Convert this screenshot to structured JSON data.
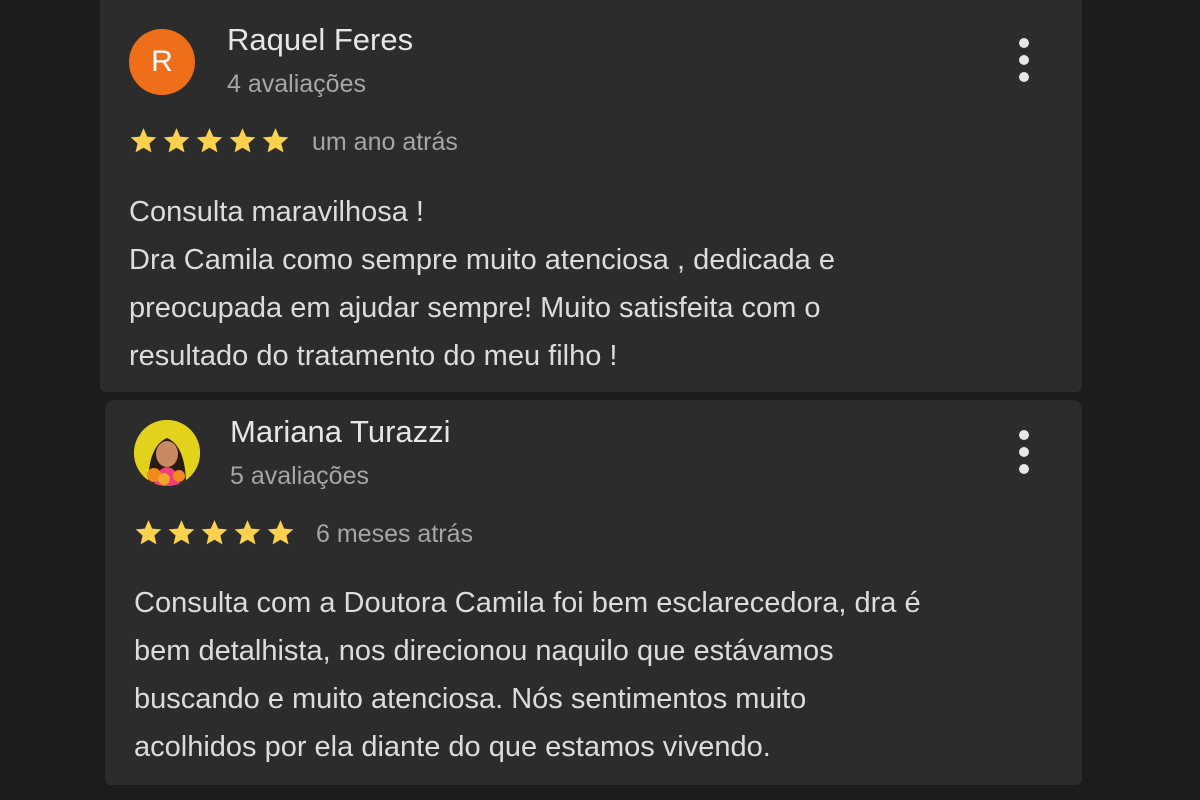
{
  "colors": {
    "background": "#1c1c1c",
    "card": "#2c2c2c",
    "avatar_orange": "#ee6e1a",
    "star": "#fbd24e",
    "text_primary": "#e6e6e6",
    "text_secondary": "#a6a6a6"
  },
  "reviews": [
    {
      "avatar_letter": "R",
      "name": "Raquel Feres",
      "reviews_count": "4 avaliações",
      "rating": 5,
      "date": "um ano atrás",
      "text_lines": [
        "Consulta maravilhosa !",
        "Dra Camila como sempre muito atenciosa , dedicada e",
        "preocupada em ajudar sempre! Muito satisfeita com o",
        "resultado do tratamento do meu filho !"
      ],
      "menu_icon": "more-vert-icon"
    },
    {
      "avatar_letter": "",
      "name": "Mariana Turazzi",
      "reviews_count": "5 avaliações",
      "rating": 5,
      "date": "6 meses atrás",
      "text_lines": [
        "Consulta com a Doutora Camila foi bem esclarecedora, dra é",
        "bem detalhista, nos direcionou naquilo que estávamos",
        "buscando e muito atenciosa. Nós sentimentos muito",
        "acolhidos por ela diante do que estamos vivendo."
      ],
      "menu_icon": "more-vert-icon"
    }
  ]
}
